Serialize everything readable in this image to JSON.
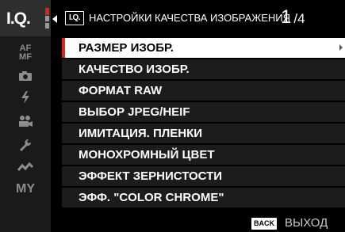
{
  "sidebar": {
    "active_tab": "I.Q.",
    "icons": [
      "af-mf-icon",
      "camera-icon",
      "flash-icon",
      "movie-icon",
      "wrench-icon",
      "connection-icon",
      "my-menu-icon"
    ],
    "af_line1": "AF",
    "af_line2": "MF",
    "my_label": "MY"
  },
  "header": {
    "icon_text": "I.Q.",
    "title": "НАСТРОЙКИ КАЧЕСТВА ИЗОБРАЖЕНИЯ",
    "page_current": "1",
    "page_total": "/4"
  },
  "menu": {
    "items": [
      {
        "label": "РАЗМЕР ИЗОБР."
      },
      {
        "label": "КАЧЕСТВО ИЗОБР."
      },
      {
        "label": "ФОРМАТ RAW"
      },
      {
        "label": "ВЫБОР JPEG/HEIF"
      },
      {
        "label": "ИМИТАЦИЯ. ПЛЕНКИ"
      },
      {
        "label": "МОНОХРОМНЫЙ ЦВЕТ"
      },
      {
        "label": "ЭФФЕКТ ЗЕРНИСТОСТИ"
      },
      {
        "label": "ЭФФ. \"COLOR CHROME\""
      }
    ],
    "selected_index": 0
  },
  "footer": {
    "back_key": "BACK",
    "exit_label": "ВЫХОД"
  },
  "colors": {
    "accent_red": "#d7261e",
    "selected_bg": "#ffffff",
    "row_bg": "#1c1c1c",
    "sidebar_bg": "#1a1a1a"
  }
}
